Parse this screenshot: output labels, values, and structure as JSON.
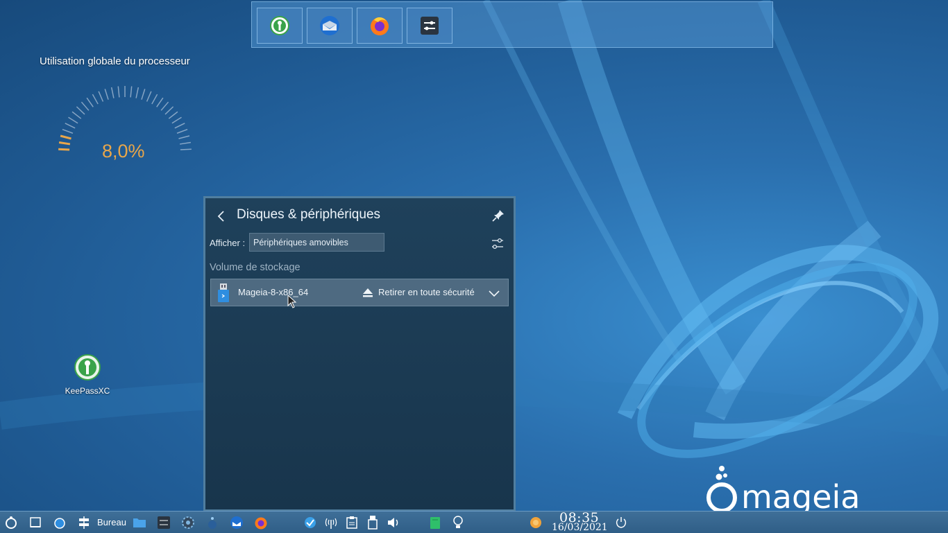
{
  "desktop": {
    "cpu_widget": {
      "title": "Utilisation globale du processeur",
      "value": "8,0%",
      "level": 0.08,
      "accent": "#e8a64a"
    },
    "icons": [
      {
        "label": "KeePassXC",
        "icon": "keepassxc-icon"
      }
    ],
    "logo_text": "mageia"
  },
  "launcher": {
    "apps": [
      {
        "icon": "keepassxc-icon"
      },
      {
        "icon": "thunderbird-icon"
      },
      {
        "icon": "firefox-icon"
      },
      {
        "icon": "system-settings-icon"
      }
    ]
  },
  "popup": {
    "title": "Disques & périphériques",
    "filter_label": "Afficher :",
    "filter_value": "Périphériques amovibles",
    "section_title": "Volume de stockage",
    "device": {
      "name": "Mageia-8-x86_64",
      "action": "Retirer en toute sécurité"
    }
  },
  "taskbar": {
    "desktop_label": "Bureau",
    "clock": {
      "time": "08:35",
      "date": "16/03/2021"
    }
  }
}
